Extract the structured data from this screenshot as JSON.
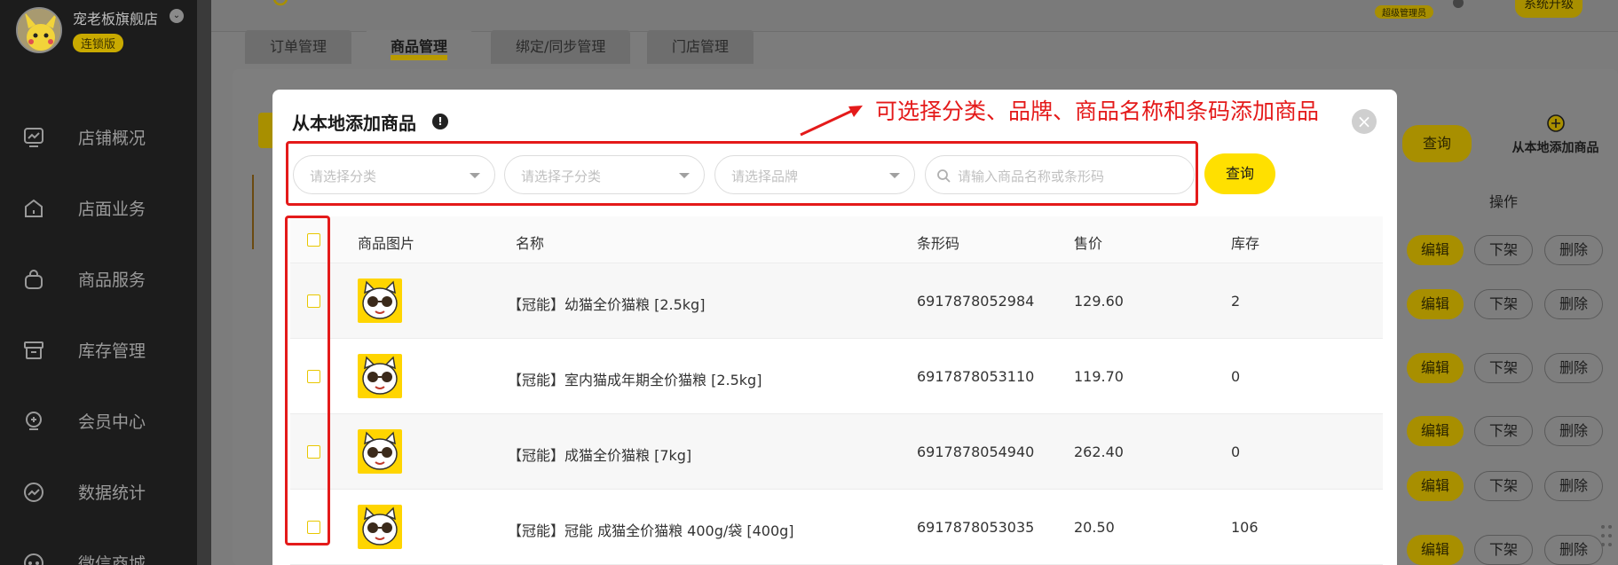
{
  "sidebar": {
    "shop_name": "宠老板旗舰店",
    "badge": "连锁版",
    "items": [
      {
        "label": "店铺概况",
        "icon": "dashboard-icon"
      },
      {
        "label": "店面业务",
        "icon": "store-icon"
      },
      {
        "label": "商品服务",
        "icon": "bag-icon"
      },
      {
        "label": "库存管理",
        "icon": "inventory-icon"
      },
      {
        "label": "会员中心",
        "icon": "member-icon"
      },
      {
        "label": "数据统计",
        "icon": "chart-icon"
      },
      {
        "label": "微信商城",
        "icon": "wechat-icon"
      }
    ]
  },
  "topbar": {
    "admin_badge": "超级管理员",
    "upgrade_label": "系统升级"
  },
  "tabs": [
    {
      "label": "订单管理",
      "active": false
    },
    {
      "label": "商品管理",
      "active": true
    },
    {
      "label": "绑定/同步管理",
      "active": false
    },
    {
      "label": "门店管理",
      "active": false
    }
  ],
  "background": {
    "query_label": "查询",
    "add_local_label": "从本地添加商品",
    "op_header": "操作",
    "row_actions": {
      "edit": "编辑",
      "offshelf": "下架",
      "delete": "删除"
    }
  },
  "modal": {
    "title": "从本地添加商品",
    "close": "×",
    "filters": {
      "category_placeholder": "请选择分类",
      "subcategory_placeholder": "请选择子分类",
      "brand_placeholder": "请选择品牌",
      "search_placeholder": "请输入商品名称或条形码",
      "query_label": "查询"
    },
    "table": {
      "headers": {
        "image": "商品图片",
        "name": "名称",
        "barcode": "条形码",
        "price": "售价",
        "stock": "库存"
      },
      "rows": [
        {
          "name": "【冠能】幼猫全价猫粮 [2.5kg]",
          "barcode": "6917878052984",
          "price": "129.60",
          "stock": "2"
        },
        {
          "name": "【冠能】室内猫成年期全价猫粮 [2.5kg]",
          "barcode": "6917878053110",
          "price": "119.70",
          "stock": "0"
        },
        {
          "name": "【冠能】成猫全价猫粮 [7kg]",
          "barcode": "6917878054940",
          "price": "262.40",
          "stock": "0"
        },
        {
          "name": "【冠能】冠能 成猫全价猫粮 400g/袋 [400g]",
          "barcode": "6917878053035",
          "price": "20.50",
          "stock": "106"
        }
      ]
    }
  },
  "annotation": {
    "text": "可选择分类、品牌、商品名称和条码添加商品",
    "color": "#e41a1a"
  }
}
